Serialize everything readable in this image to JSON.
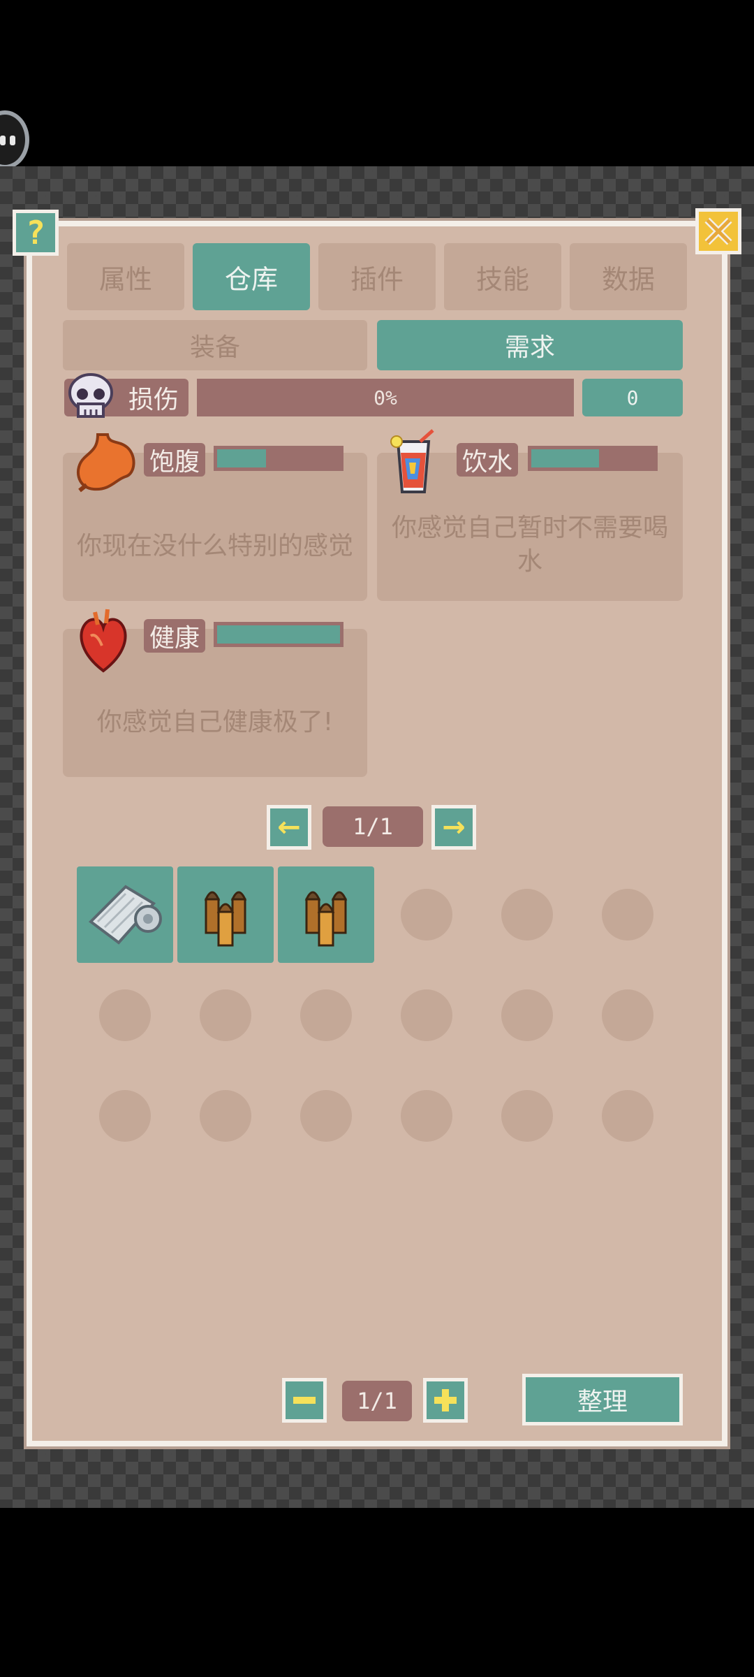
{
  "tabs": [
    "属性",
    "仓库",
    "插件",
    "技能",
    "数据"
  ],
  "active_tab": 1,
  "subtabs": [
    "装备",
    "需求"
  ],
  "active_subtab": 1,
  "damage": {
    "label": "损伤",
    "percent_text": "0%",
    "value": "0"
  },
  "needs": [
    {
      "label": "饱腹",
      "description": "你现在没什么特别的感觉",
      "level": 0.4,
      "icon": "stomach-icon"
    },
    {
      "label": "饮水",
      "description": "你感觉自己暂时不需要喝水",
      "level": 0.55,
      "icon": "drink-icon"
    },
    {
      "label": "健康",
      "description": "你感觉自己健康极了!",
      "level": 1.0,
      "icon": "heart-icon"
    }
  ],
  "pager_top": {
    "text": "1/1"
  },
  "pager_bottom": {
    "text": "1/1"
  },
  "inventory_items": [
    "bandage-roll-icon",
    "bullets-icon",
    "bullets-icon"
  ],
  "sort_button": "整理",
  "help_label": "?"
}
